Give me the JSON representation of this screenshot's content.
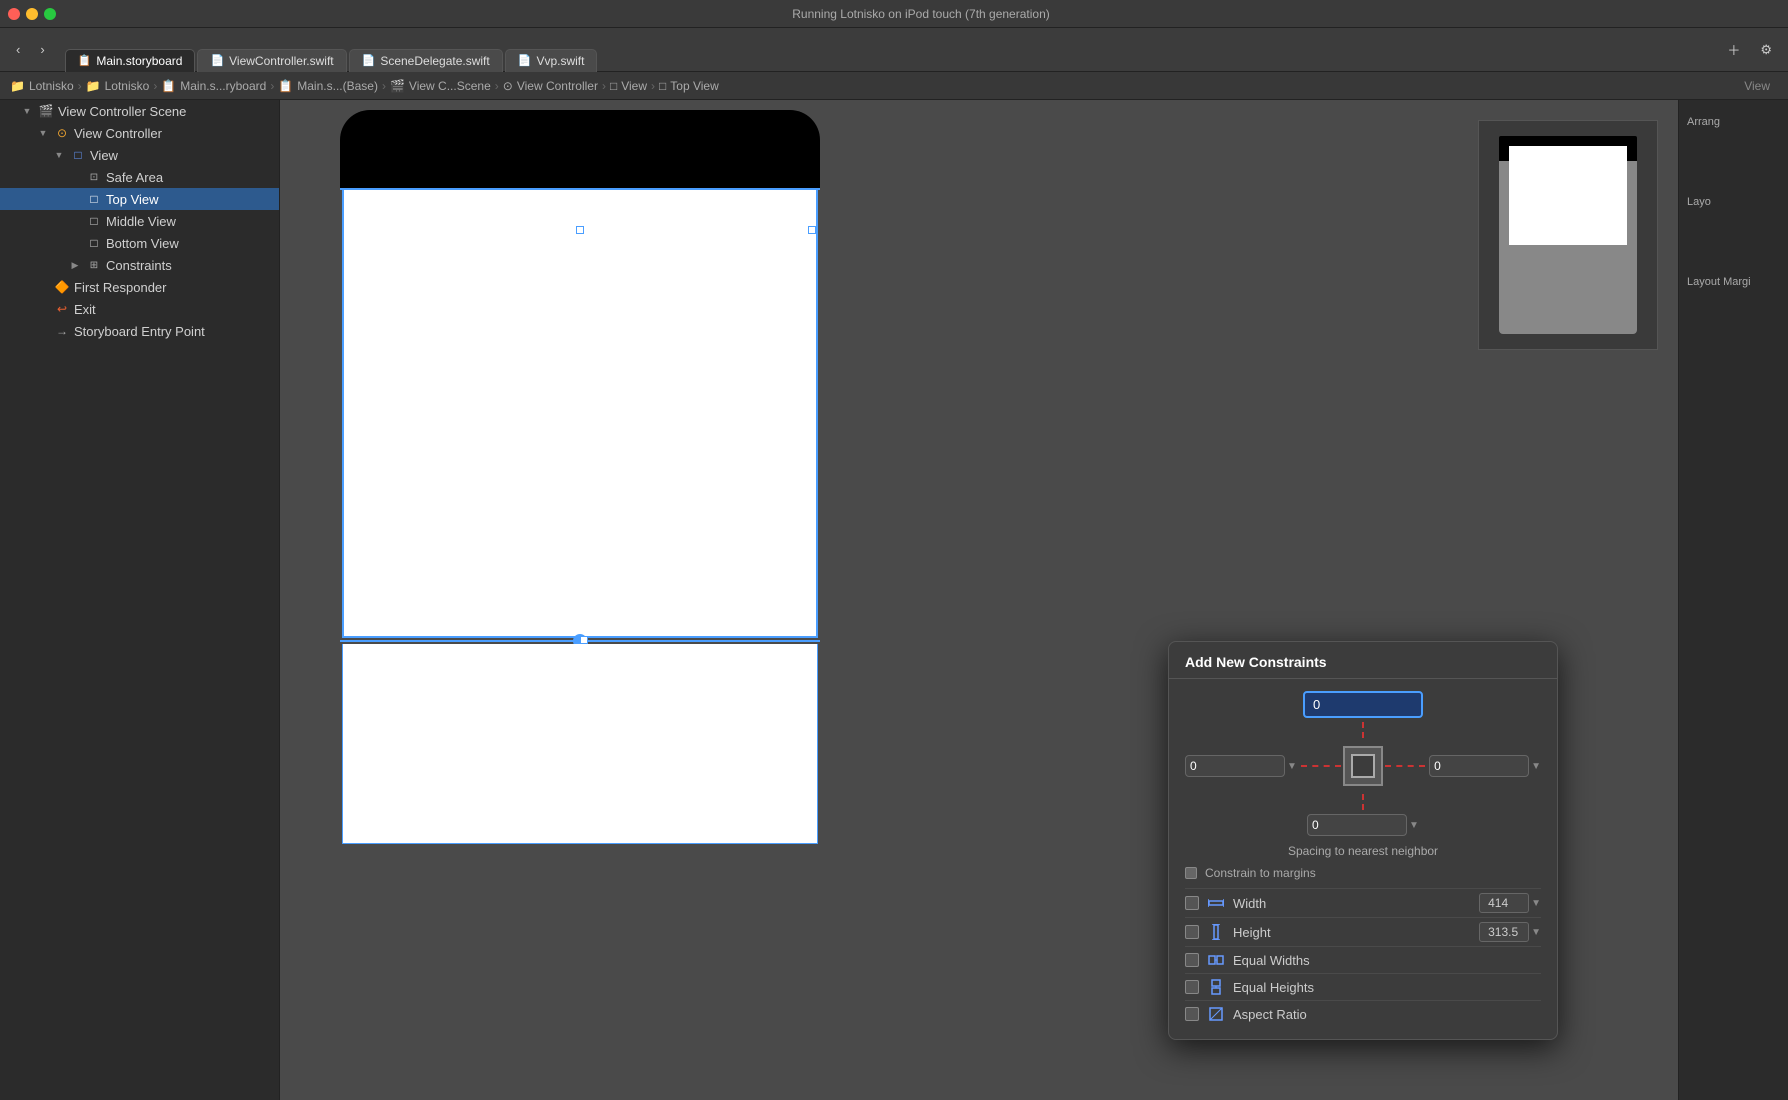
{
  "window": {
    "title": "Lotnisko — iPod touch (7th generation)"
  },
  "titlebar": {
    "app": "Lotnisko",
    "device": "iPod touch (7th generation)",
    "status": "Running Lotnisko on iPod touch (7th generation)"
  },
  "toolbar": {
    "back_label": "‹",
    "forward_label": "›",
    "tabs": [
      {
        "id": "main-storyboard",
        "label": "Main.storyboard",
        "icon": "📋",
        "active": true
      },
      {
        "id": "viewcontroller-swift",
        "label": "ViewController.swift",
        "icon": "📄",
        "active": false
      },
      {
        "id": "scenedelegate-swift",
        "label": "SceneDelegate.swift",
        "icon": "📄",
        "active": false
      },
      {
        "id": "vvp-swift",
        "label": "Vvp.swift",
        "icon": "📄",
        "active": false
      }
    ]
  },
  "breadcrumb": {
    "items": [
      {
        "label": "Lotnisko",
        "icon": "📁"
      },
      {
        "label": "Lotnisko",
        "icon": "📁"
      },
      {
        "label": "Main.s...ryboard",
        "icon": "📋"
      },
      {
        "label": "Main.s...(Base)",
        "icon": "📋"
      },
      {
        "label": "View C...Scene",
        "icon": "🎬"
      },
      {
        "label": "View Controller",
        "icon": "⊙"
      },
      {
        "label": "View",
        "icon": "□"
      },
      {
        "label": "Top View",
        "icon": "□"
      }
    ],
    "right_label": "View"
  },
  "sidebar": {
    "title": "View Controller Scene",
    "tree": [
      {
        "id": "vc-scene",
        "label": "View Controller Scene",
        "level": 0,
        "expanded": true,
        "icon": "scene"
      },
      {
        "id": "vc",
        "label": "View Controller",
        "level": 1,
        "expanded": true,
        "icon": "vc"
      },
      {
        "id": "view",
        "label": "View",
        "level": 2,
        "expanded": true,
        "icon": "view"
      },
      {
        "id": "safe-area",
        "label": "Safe Area",
        "level": 3,
        "expanded": false,
        "icon": "safearea"
      },
      {
        "id": "top-view",
        "label": "Top View",
        "level": 3,
        "expanded": false,
        "icon": "view",
        "selected": true
      },
      {
        "id": "middle-view",
        "label": "Middle View",
        "level": 3,
        "expanded": false,
        "icon": "view"
      },
      {
        "id": "bottom-view",
        "label": "Bottom View",
        "level": 3,
        "expanded": false,
        "icon": "view"
      },
      {
        "id": "constraints",
        "label": "Constraints",
        "level": 3,
        "expanded": false,
        "icon": "constraint"
      },
      {
        "id": "first-responder",
        "label": "First Responder",
        "level": 1,
        "expanded": false,
        "icon": "first-responder"
      },
      {
        "id": "exit",
        "label": "Exit",
        "level": 1,
        "expanded": false,
        "icon": "exit"
      },
      {
        "id": "entry-point",
        "label": "Storyboard Entry Point",
        "level": 1,
        "expanded": false,
        "icon": "entry"
      }
    ]
  },
  "canvas": {
    "device": "iPhone",
    "scale": "1x"
  },
  "right_panel": {
    "labels": [
      "Arrang",
      "Layo",
      "Layout Margi"
    ]
  },
  "constraints_popup": {
    "title": "Add New Constraints",
    "top_value": "0",
    "left_value": "0",
    "right_value": "0",
    "bottom_value": "0",
    "spacing_label": "Spacing to nearest neighbor",
    "constrain_to_margins": "Constrain to margins",
    "items": [
      {
        "id": "width",
        "label": "Width",
        "value": "414",
        "icon": "width-icon",
        "checked": false
      },
      {
        "id": "height",
        "label": "Height",
        "value": "313.5",
        "icon": "height-icon",
        "checked": false
      },
      {
        "id": "equal-widths",
        "label": "Equal Widths",
        "icon": "equal-widths-icon",
        "value": "",
        "checked": false
      },
      {
        "id": "equal-heights",
        "label": "Equal Heights",
        "icon": "equal-heights-icon",
        "value": "",
        "checked": false
      },
      {
        "id": "aspect-ratio",
        "label": "Aspect Ratio",
        "icon": "aspect-ratio-icon",
        "value": "",
        "checked": false
      }
    ]
  }
}
